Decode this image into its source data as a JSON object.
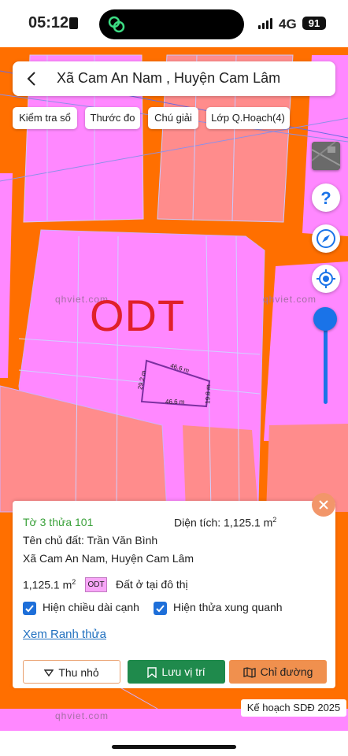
{
  "status_bar": {
    "time": "05:12",
    "network": "4G",
    "battery": "91"
  },
  "header": {
    "title": "Xã Cam An Nam , Huyện Cam Lâm"
  },
  "toolbar": {
    "check_book": "Kiểm tra sổ",
    "ruler": "Thước đo",
    "legend": "Chú giải",
    "layers": "Lớp Q.Hoạch(4)"
  },
  "map": {
    "zone_label": "ODT",
    "watermarks": [
      "qhviet.com",
      "qhviet.com",
      "qhviet.com"
    ],
    "dimensions": {
      "top": "46.6 m",
      "bottom": "46.6 m",
      "left": "29.2 m",
      "right": "19.8 m"
    },
    "colors": {
      "road": "#ff6f00",
      "urban_land": "#ff88ff",
      "other_land": "#ff8c8c",
      "plot_outline": "#7b2fa0"
    }
  },
  "panel": {
    "plot_id": "Tờ 3 thửa 101",
    "area_label": "Diện tích: 1,125.1 m",
    "area_sup": "2",
    "owner": "Tên chủ đất: Trần Văn Bình",
    "address": "Xã Cam An Nam, Huyện Cam Lâm",
    "area_value": "1,125.1 m",
    "area_value_sup": "2",
    "land_code": "ODT",
    "land_type": "Đất ở tại đô thị",
    "checkbox_edges": "Hiện chiều dài cạnh",
    "checkbox_neighbors": "Hiện thửa xung quanh",
    "link_boundary": "Xem Ranh thửa"
  },
  "buttons": {
    "shrink": "Thu nhỏ",
    "save": "Lưu vị trí",
    "route": "Chỉ đường"
  },
  "footer": {
    "plan_label": "Kế hoạch SDĐ 2025"
  }
}
